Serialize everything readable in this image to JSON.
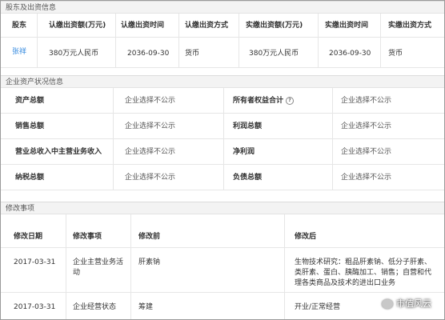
{
  "shareholders": {
    "section_title": "股东及出资信息",
    "headers": [
      "股东",
      "认缴出资额(万元)",
      "认缴出资时间",
      "认缴出资方式",
      "实缴出资额(万元)",
      "实缴出资时间",
      "实缴出资方式"
    ],
    "rows": [
      [
        "张祥",
        "380万元人民币",
        "2036-09-30",
        "货币",
        "380万元人民币",
        "2036-09-30",
        "货币"
      ]
    ]
  },
  "assets": {
    "section_title": "企业资产状况信息",
    "rows": [
      {
        "l1": "资产总额",
        "v1": "企业选择不公示",
        "l2": "所有者权益合计",
        "v2": "企业选择不公示",
        "info": "?"
      },
      {
        "l1": "销售总额",
        "v1": "企业选择不公示",
        "l2": "利润总额",
        "v2": "企业选择不公示"
      },
      {
        "l1": "营业总收入中主营业务收入",
        "v1": "企业选择不公示",
        "l2": "净利润",
        "v2": "企业选择不公示"
      },
      {
        "l1": "纳税总额",
        "v1": "企业选择不公示",
        "l2": "负债总额",
        "v2": "企业选择不公示"
      }
    ]
  },
  "changes": {
    "section_title": "修改事项",
    "headers": [
      "修改日期",
      "修改事项",
      "修改前",
      "修改后"
    ],
    "rows": [
      {
        "date": "2017-03-31",
        "item_lines": [
          "企业主营业务活",
          "动"
        ],
        "before": "肝素钠",
        "after_lines": [
          "生物技术研究：粗品肝素钠、低分子肝素、",
          "类肝素、蛋白、胰酶加工、销售；自营和代",
          "理各类商品及技术的进出口业务"
        ]
      },
      {
        "date": "2017-03-31",
        "item_lines": [
          "企业经营状态"
        ],
        "before": "筹建",
        "after_lines": [
          "开业/正常经营"
        ]
      }
    ]
  },
  "watermark": {
    "text": "市值风云"
  }
}
